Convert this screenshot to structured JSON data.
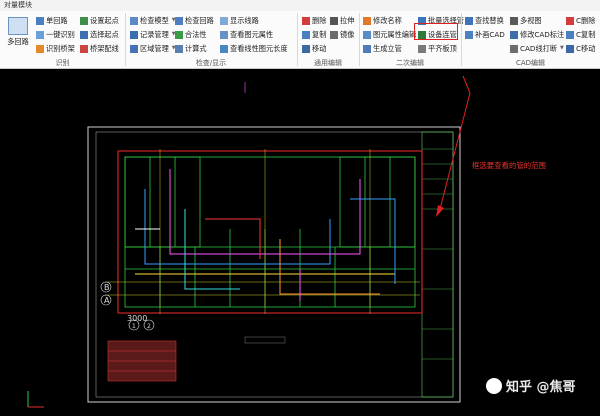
{
  "window": {
    "title": "对量模块"
  },
  "ribbon": {
    "identify": {
      "multi_loop": "多回路",
      "single_loop": "单回路",
      "one_click": "一键识别",
      "identify_bridge": "识别桥架",
      "set_start": "设置起点",
      "select_start": "选择起点",
      "bridge_wiring": "桥架配线",
      "label": "识别"
    },
    "check": {
      "check_model": "检查模型",
      "check_loop": "检查回路",
      "show_lines": "显示线路",
      "record_mgmt": "记录管理",
      "validity": "合法性",
      "view_props": "查看图元属性",
      "area_mgmt": "区域管理",
      "calculator": "计算式",
      "view_length": "查看线性图元长度",
      "label": "检查/显示"
    },
    "common": {
      "delete": "删除",
      "stretch": "拉伸",
      "copy": "复制",
      "mirror": "镜像",
      "move": "移动",
      "label": "通用编辑"
    },
    "secondary": {
      "rename": "修改名称",
      "batch_select_pipe": "批量选择管",
      "prop_edit": "图元属性编辑",
      "equipment_conn": "设备连管",
      "gen_riser": "生成立管",
      "flat_top": "平齐板顶",
      "label": "二次编辑"
    },
    "cad": {
      "find_replace": "查找替换",
      "multi_view": "多视图",
      "c_delete": "C删除",
      "patch_cad": "补画CAD",
      "edit_cad_label": "修改CAD标注",
      "c_copy": "C复制",
      "cad_break": "CAD线打断",
      "c_move": "C移动",
      "label": "CAD编辑"
    }
  },
  "annotation": {
    "text": "框选要查看的管的范围"
  },
  "drawing": {
    "axis_b": "B",
    "axis_a": "A",
    "dim_1": "3000",
    "dim_2": "1",
    "dim_3": "2"
  },
  "watermark": {
    "text": "知乎 @焦哥"
  },
  "colors": {
    "accent_red": "#e02020",
    "annotation_red": "#e8322b",
    "canvas_bg": "#000000"
  }
}
